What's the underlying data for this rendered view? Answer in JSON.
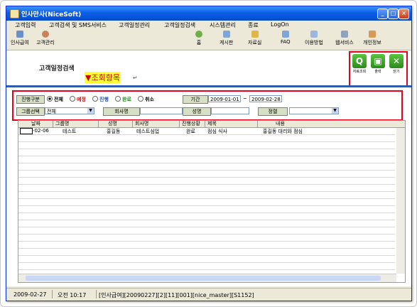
{
  "window": {
    "title": "인사만사(NiceSoft)"
  },
  "menu": [
    "고객입력",
    "고객검색 및 SMS서비스",
    "고객일정관리",
    "고객일정검색",
    "시스템관리",
    "종료",
    "LogOn"
  ],
  "toolbar_left": [
    "인사급여",
    "고객관리"
  ],
  "toolbar_right": [
    "홈",
    "게시판",
    "자료실",
    "FAQ",
    "이용방법",
    "웹서비스",
    "개인정보"
  ],
  "page": {
    "title": "고객일정검색",
    "search_label": "▼조회항목",
    "return_mark": "↵"
  },
  "actions": {
    "query": "자료조회",
    "print": "출력",
    "close": "닫기"
  },
  "filter": {
    "status_label": "진행구분",
    "status_options": [
      "전체",
      "예정",
      "진행",
      "완료",
      "취소"
    ],
    "status_selected": "전체",
    "period_label": "기간",
    "date_from": "2009-01-01",
    "date_sep": "~",
    "date_to": "2009-02-28",
    "group_label": "그룹선택",
    "group_value": "전체",
    "company_label": "회사명",
    "company_value": "",
    "name_label": "성명",
    "name_value": "",
    "sort_label": "정렬",
    "sort_value": ""
  },
  "table": {
    "columns": [
      "날짜",
      "그룹명",
      "성명",
      "회사명",
      "진행상황",
      "제목",
      "내용"
    ],
    "rows": [
      [
        "-02-06",
        "테스트",
        "홍길동",
        "테스트심업",
        "완료",
        "점심 식사",
        "홍길동 대리와 점심"
      ]
    ]
  },
  "status": {
    "date": "2009-02-27",
    "time": "오전 10:17",
    "info": "[인사급여][20090227][2][11][001][nice_master][S1152]"
  }
}
